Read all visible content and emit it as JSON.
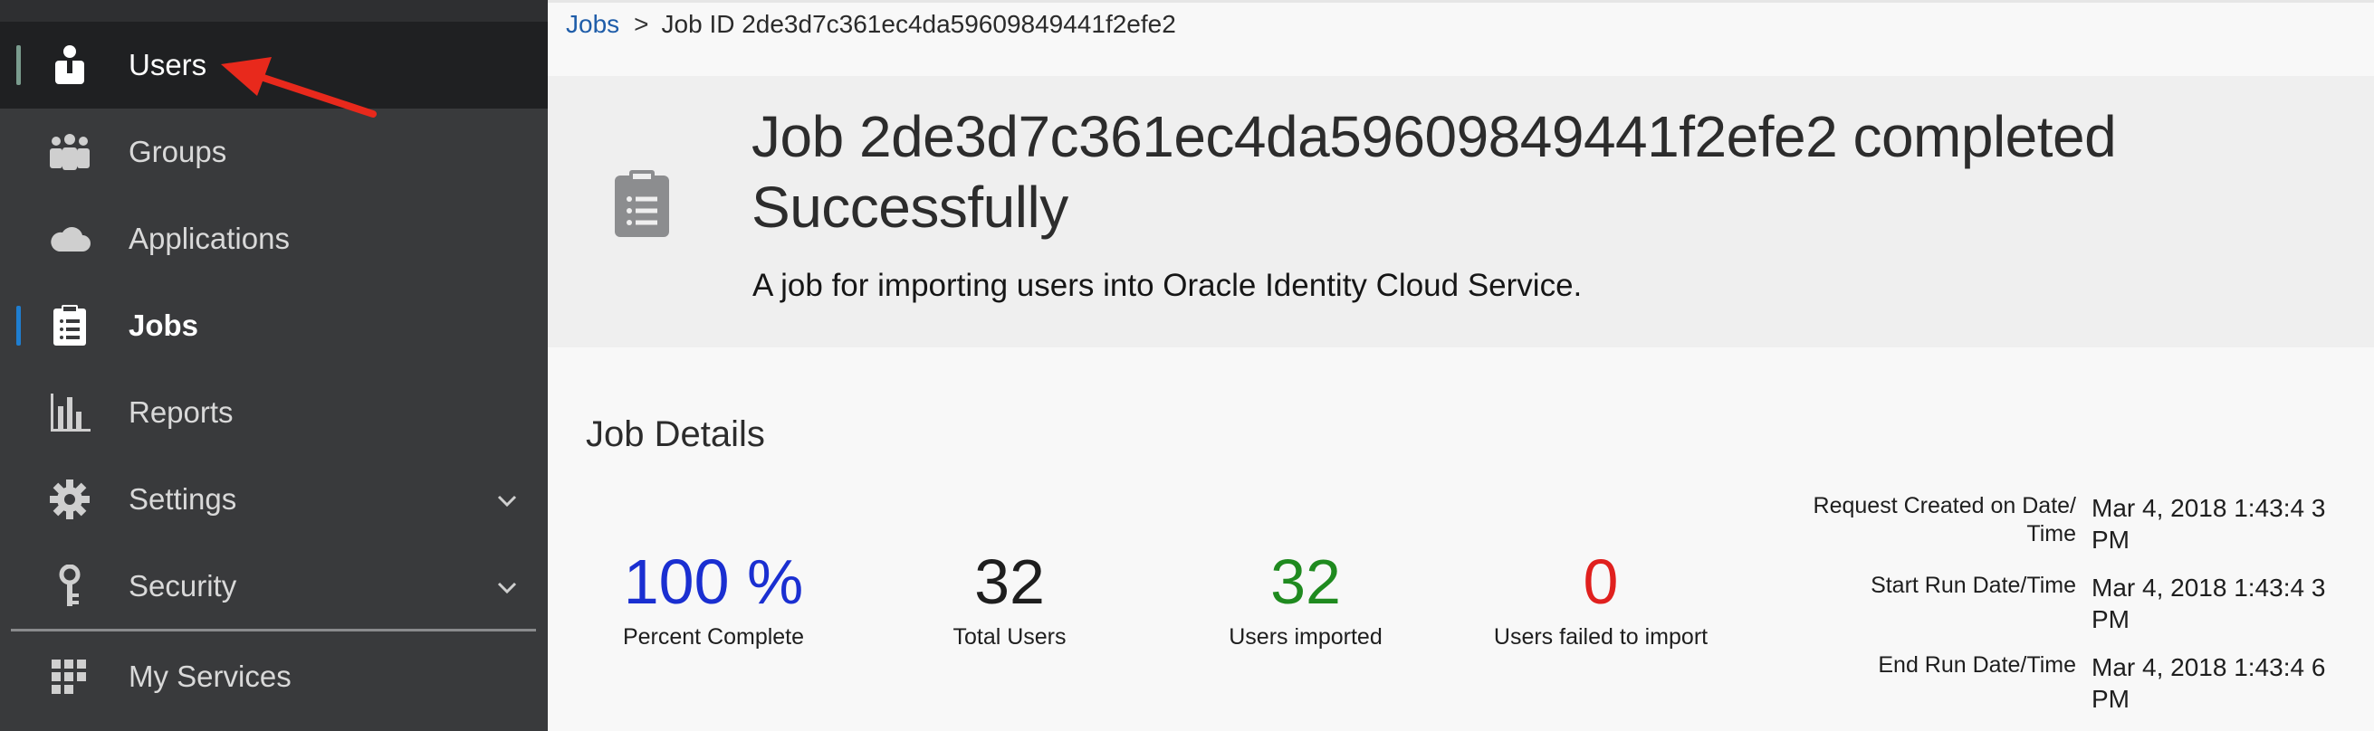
{
  "sidebar": {
    "items": [
      {
        "label": "Users",
        "icon": "user-icon"
      },
      {
        "label": "Groups",
        "icon": "groups-icon"
      },
      {
        "label": "Applications",
        "icon": "cloud-icon"
      },
      {
        "label": "Jobs",
        "icon": "clipboard-list-icon"
      },
      {
        "label": "Reports",
        "icon": "bar-chart-icon"
      },
      {
        "label": "Settings",
        "icon": "gear-icon"
      },
      {
        "label": "Security",
        "icon": "key-icon"
      },
      {
        "label": "My Services",
        "icon": "grid-icon"
      }
    ]
  },
  "breadcrumb": {
    "jobs_link": "Jobs",
    "separator": ">",
    "current": "Job ID 2de3d7c361ec4da59609849441f2efe2"
  },
  "banner": {
    "title": "Job 2de3d7c361ec4da59609849441f2efe2 completed Successfully",
    "description": "A job for importing users into Oracle Identity Cloud Service."
  },
  "details": {
    "heading": "Job Details",
    "stats": [
      {
        "value": "100 %",
        "caption": "Percent Complete",
        "color": "#1a2fd1"
      },
      {
        "value": "32",
        "caption": "Total Users",
        "color": "#1e1e1e"
      },
      {
        "value": "32",
        "caption": "Users imported",
        "color": "#1f8a1f"
      },
      {
        "value": "0",
        "caption": "Users failed to import",
        "color": "#e0201e"
      }
    ],
    "meta": [
      {
        "key": "Request Created on Date/ Time",
        "value": "Mar 4, 2018 1:43:4 3 PM"
      },
      {
        "key": "Start Run Date/Time",
        "value": "Mar 4, 2018 1:43:4 3 PM"
      },
      {
        "key": "End Run Date/Time",
        "value": "Mar 4, 2018 1:43:4 6 PM"
      }
    ]
  },
  "colors": {
    "sidebar_bg": "#393a3c",
    "selected_bg": "#1f2022",
    "active_indicator": "#1f7ed0",
    "hover_indicator": "#7a9c8e",
    "link": "#1f5da9",
    "annotation_arrow": "#e8291c"
  }
}
